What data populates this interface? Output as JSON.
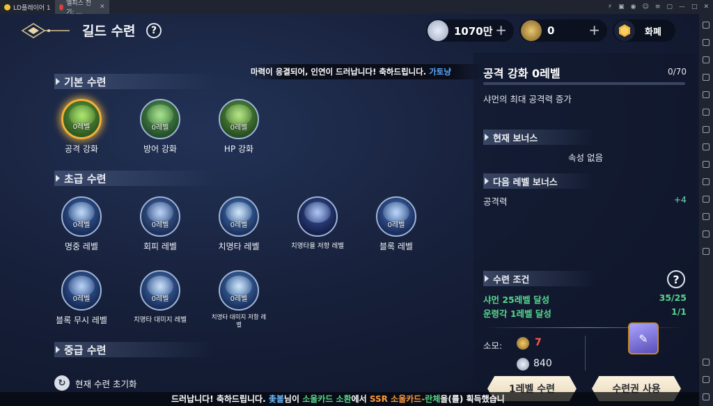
{
  "emulator": {
    "tabs": [
      {
        "label": "LD플레이어 1"
      },
      {
        "label": "엘피스 전기: ..."
      }
    ],
    "controls": [
      "⚡",
      "▣",
      "◉",
      "☺",
      "≡",
      "▢",
      "—",
      "□",
      "✕"
    ]
  },
  "header": {
    "title": "길드 수련",
    "help": "?",
    "currency": [
      {
        "icon": "silver-coin-icon",
        "value": "1070만",
        "plus": "+"
      },
      {
        "icon": "guild-medal-icon",
        "value": "0",
        "plus": "+"
      },
      {
        "icon": "gem-icon",
        "value": "화폐"
      }
    ]
  },
  "marquee": {
    "text": "마력이 응결되어, 인연이 드러납니다! 축하드립니다. ",
    "highlight": "가토냥"
  },
  "sections": [
    {
      "title": "기본 수련",
      "skills": [
        {
          "level": "0레벨",
          "label": "공격 강화",
          "selected": true,
          "color": "#7ec84a"
        },
        {
          "level": "0레벨",
          "label": "방어 강화",
          "color": "#6fc06a"
        },
        {
          "level": "0레벨",
          "label": "HP 강화",
          "color": "#7bc45e"
        }
      ]
    },
    {
      "title": "초급 수련",
      "skills": [
        {
          "level": "0레벨",
          "label": "명중 레벨",
          "color": "#7fb8f0"
        },
        {
          "level": "0레벨",
          "label": "회피 레벨",
          "color": "#8fb4e6"
        },
        {
          "level": "0레벨",
          "label": "치명타 레벨",
          "color": "#86c4f5"
        },
        {
          "level": "",
          "label": "치명타율 저항 레벨",
          "color": "#6f8fd8"
        },
        {
          "level": "0레벨",
          "label": "블록 레벨",
          "color": "#7ab0ea"
        },
        {
          "level": "0레벨",
          "label": "블록 무시 레벨",
          "color": "#6a9de0"
        },
        {
          "level": "0레벨",
          "label": "치명타 대미지 레벨",
          "color": "#7fb8f0"
        },
        {
          "level": "0레벨",
          "label": "치명타 대미지 저항 레벨",
          "color": "#82bdf2"
        }
      ]
    },
    {
      "title": "중급 수련"
    }
  ],
  "reset": {
    "label": "현재 수련 초기화"
  },
  "detail": {
    "title": "공격 강화  0레벨",
    "progress": "0/70",
    "progress_fraction": 0,
    "description": "샤먼의 최대 공격력 증가",
    "current_bonus": {
      "title": "현재 보너스",
      "value": "속성 없음"
    },
    "next_bonus": {
      "title": "다음 레벨 보너스",
      "stat": "공격력",
      "value": "+4"
    },
    "conditions": {
      "title": "수련 조건",
      "help": "?",
      "items": [
        {
          "text": "샤먼 25레벨 달성",
          "value": "35/25"
        },
        {
          "text": "운령각 1레벨 달성",
          "value": "1/1"
        }
      ]
    },
    "cost": {
      "label": "소모:",
      "medal": "7",
      "silver": "840"
    },
    "buttons": {
      "train": "1레벨 수련",
      "voucher": "수련권 사용"
    }
  },
  "ticker": {
    "parts": [
      {
        "text": "드러납니다! 축하드립니다. ",
        "color": "#ffffff"
      },
      {
        "text": "촟볼",
        "color": "#6ab8ff"
      },
      {
        "text": "님이 ",
        "color": "#ffffff"
      },
      {
        "text": "소울카드 소환",
        "color": "#58d98a"
      },
      {
        "text": "에서 ",
        "color": "#ffffff"
      },
      {
        "text": "SSR 소울카드-",
        "color": "#ff9a3c"
      },
      {
        "text": "란체",
        "color": "#58d98a"
      },
      {
        "text": "을(를) 획득했습니",
        "color": "#ffffff"
      }
    ]
  }
}
